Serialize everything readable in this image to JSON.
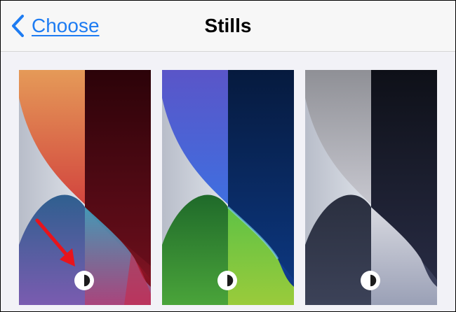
{
  "navbar": {
    "back_label": "Choose",
    "title": "Stills"
  },
  "colors": {
    "accent": "#1e7cf2",
    "annotation_arrow": "#e8141c"
  },
  "icons": {
    "back": "chevron-left-icon",
    "appearance_mode": "light-dark-mode-icon"
  },
  "wallpapers": [
    {
      "name": "wallpaper-red",
      "palette": "red",
      "light_side": [
        "#e59a58",
        "#d2453e"
      ],
      "dark_side": [
        "#2a0307",
        "#7a1421"
      ]
    },
    {
      "name": "wallpaper-blue-green",
      "palette": "blue-green",
      "light_side": [
        "#4a5fcf",
        "#3f6fe0"
      ],
      "dark_side": [
        "#061a3e",
        "#0d3a86"
      ]
    },
    {
      "name": "wallpaper-gray",
      "palette": "gray",
      "light_side": [
        "#8f9096",
        "#c7c7cf"
      ],
      "dark_side": [
        "#0e1018",
        "#2a2e48"
      ]
    }
  ]
}
